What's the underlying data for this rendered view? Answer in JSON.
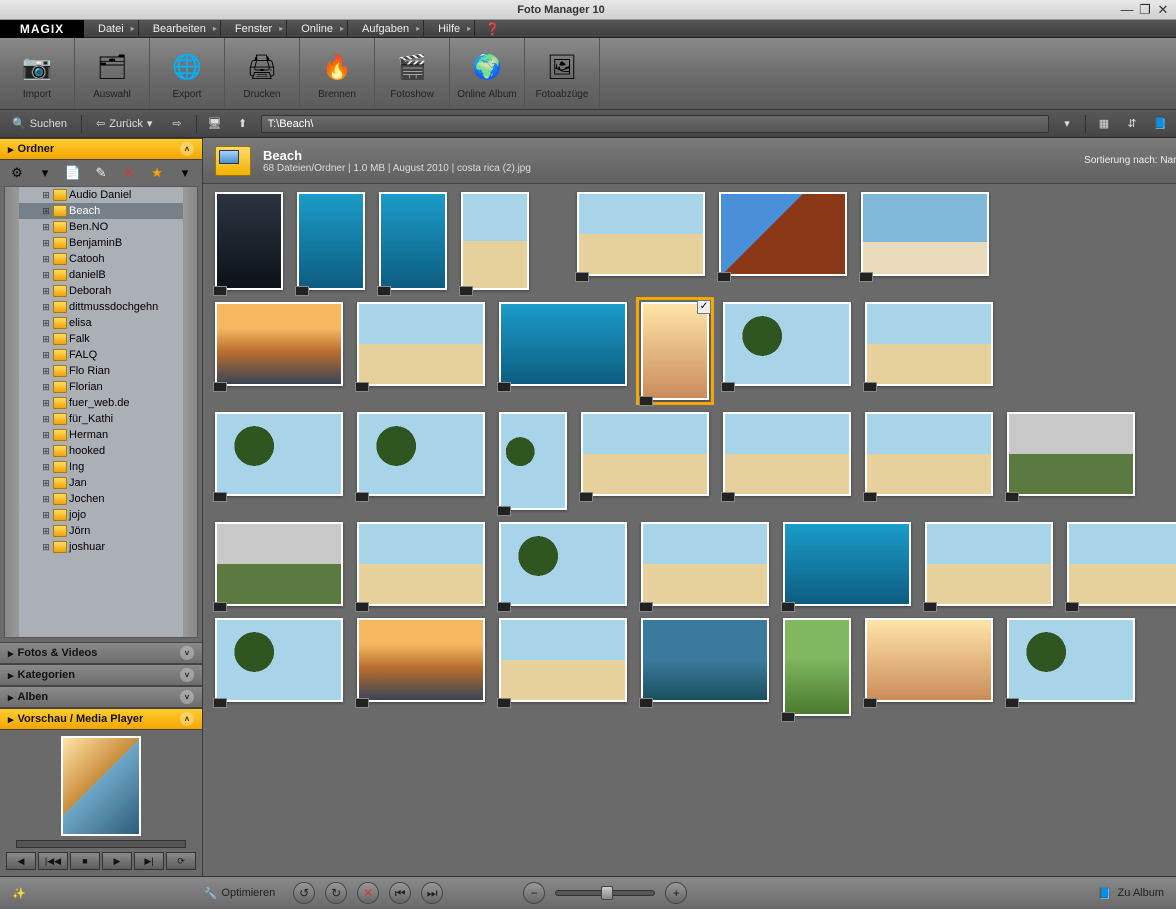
{
  "window": {
    "title": "Foto Manager 10"
  },
  "brand": "MAGIX",
  "menu": [
    "Datei",
    "Bearbeiten",
    "Fenster",
    "Online",
    "Aufgaben",
    "Hilfe"
  ],
  "toolbar": [
    {
      "label": "Import",
      "icon": "📷"
    },
    {
      "label": "Auswahl",
      "icon": "🗂"
    },
    {
      "label": "Export",
      "icon": "🌐"
    },
    {
      "label": "Drucken",
      "icon": "🖨"
    },
    {
      "label": "Brennen",
      "icon": "🔥"
    },
    {
      "label": "Fotoshow",
      "icon": "🎬"
    },
    {
      "label": "Online Album",
      "icon": "🌍"
    },
    {
      "label": "Fotoabzüge",
      "icon": "🖼"
    }
  ],
  "nav": {
    "search": "Suchen",
    "back": "Zurück",
    "path": "T:\\Beach\\"
  },
  "sidebar": {
    "ordner": "Ordner",
    "panels": [
      "Fotos & Videos",
      "Kategorien",
      "Alben",
      "Vorschau / Media Player"
    ],
    "folders": [
      "Audio Daniel",
      "Beach",
      "Ben.NO",
      "BenjaminB",
      "Catooh",
      "danielB",
      "Deborah",
      "dittmussdochgehn",
      "elisa",
      "Falk",
      "FALQ",
      "Flo Rian",
      "Florian",
      "fuer_web.de",
      "für_Kathi",
      "Herman",
      "hooked",
      "Ing",
      "Jan",
      "Jochen",
      "jojo",
      "Jörn",
      "joshuar"
    ],
    "selected": "Beach"
  },
  "header": {
    "title": "Beach",
    "stats": "68 Dateien/Ordner  |  1.0 MB  |  August 2010  |  costa rica (2).jpg",
    "sort": "Sortierung nach: Name"
  },
  "bottom": {
    "optimize": "Optimieren",
    "album": "Zu Album"
  }
}
